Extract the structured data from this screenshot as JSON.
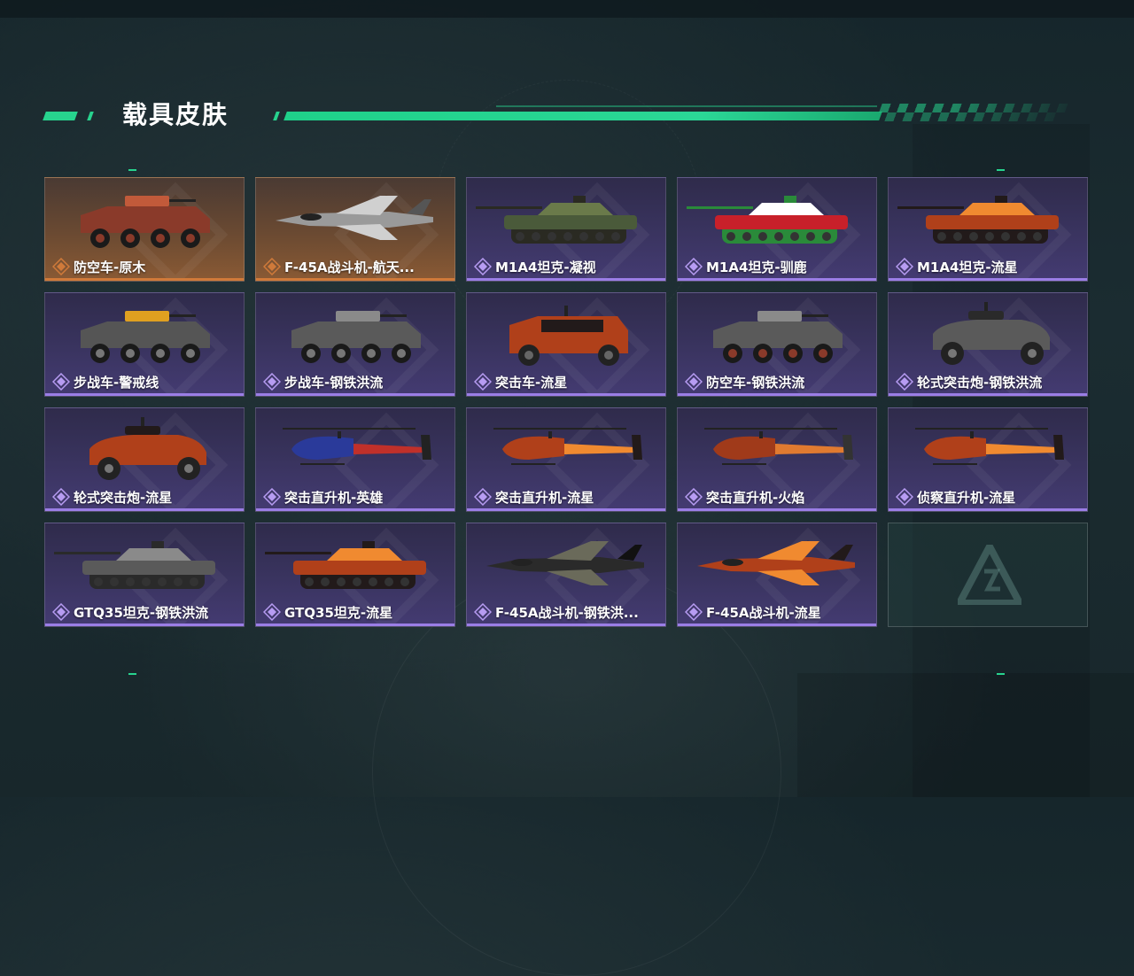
{
  "page": {
    "title": "载具皮肤"
  },
  "colors": {
    "accent": "#27d38e",
    "rarity_epic": "#9b7ee6",
    "rarity_legendary": "#d07a3a"
  },
  "skins": [
    {
      "label": "防空车-原木",
      "rarity": "legendary",
      "vehicle": "apc-aa",
      "paint": "red"
    },
    {
      "label": "F-45A战斗机-航天...",
      "rarity": "legendary",
      "vehicle": "jet",
      "paint": "silver"
    },
    {
      "label": "M1A4坦克-凝视",
      "rarity": "epic",
      "vehicle": "tank",
      "paint": "camo"
    },
    {
      "label": "M1A4坦克-驯鹿",
      "rarity": "epic",
      "vehicle": "tank",
      "paint": "xmas"
    },
    {
      "label": "M1A4坦克-流星",
      "rarity": "epic",
      "vehicle": "tank",
      "paint": "meteor"
    },
    {
      "label": "步战车-警戒线",
      "rarity": "epic",
      "vehicle": "ifv",
      "paint": "hazard"
    },
    {
      "label": "步战车-钢铁洪流",
      "rarity": "epic",
      "vehicle": "ifv",
      "paint": "steel"
    },
    {
      "label": "突击车-流星",
      "rarity": "epic",
      "vehicle": "jeep",
      "paint": "meteor"
    },
    {
      "label": "防空车-钢铁洪流",
      "rarity": "epic",
      "vehicle": "apc-aa",
      "paint": "steel"
    },
    {
      "label": "轮式突击炮-钢铁洪流",
      "rarity": "epic",
      "vehicle": "buggy",
      "paint": "steel"
    },
    {
      "label": "轮式突击炮-流星",
      "rarity": "epic",
      "vehicle": "buggy",
      "paint": "meteor"
    },
    {
      "label": "突击直升机-英雄",
      "rarity": "epic",
      "vehicle": "heli",
      "paint": "hero"
    },
    {
      "label": "突击直升机-流星",
      "rarity": "epic",
      "vehicle": "heli",
      "paint": "meteor"
    },
    {
      "label": "突击直升机-火焰",
      "rarity": "epic",
      "vehicle": "heli",
      "paint": "flame"
    },
    {
      "label": "侦察直升机-流星",
      "rarity": "epic",
      "vehicle": "scout-heli",
      "paint": "meteor"
    },
    {
      "label": "GTQ35坦克-钢铁洪流",
      "rarity": "epic",
      "vehicle": "tank",
      "paint": "steel"
    },
    {
      "label": "GTQ35坦克-流星",
      "rarity": "epic",
      "vehicle": "tank",
      "paint": "meteor"
    },
    {
      "label": "F-45A战斗机-钢铁洪...",
      "rarity": "epic",
      "vehicle": "jet",
      "paint": "dark"
    },
    {
      "label": "F-45A战斗机-流星",
      "rarity": "epic",
      "vehicle": "jet",
      "paint": "meteor"
    },
    {
      "label": "",
      "rarity": "empty",
      "vehicle": "",
      "paint": ""
    }
  ]
}
